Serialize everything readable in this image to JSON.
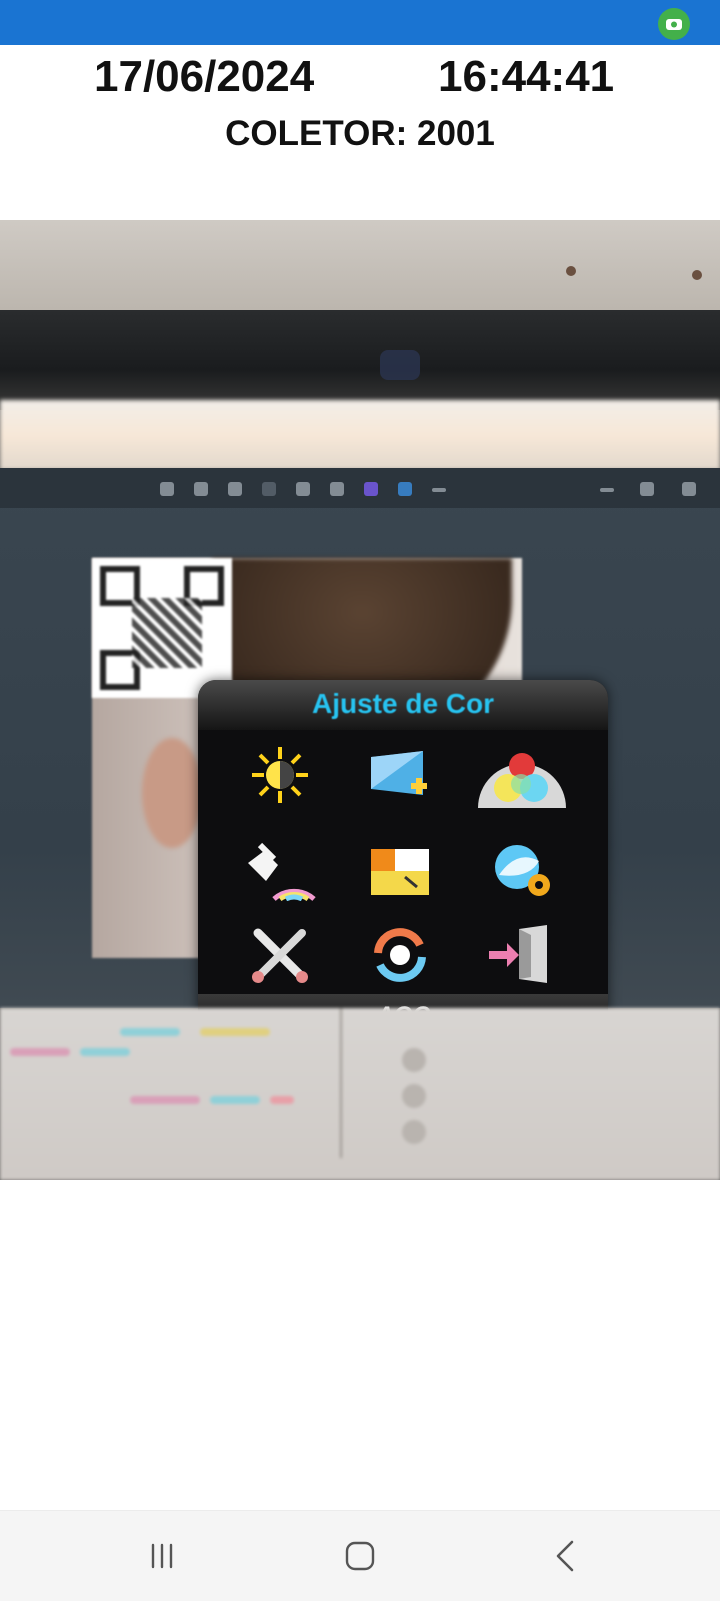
{
  "status_bar": {
    "accent_color": "#1a74d2",
    "camera_indicator_icon": "camera-in-use-icon",
    "indicator_color": "#43b04a"
  },
  "header": {
    "date": "17/06/2024",
    "time": "16:44:41",
    "collector": "COLETOR: 2001"
  },
  "camera_preview": {
    "osd": {
      "title": "Ajuste de Cor",
      "brand": "AOC",
      "tiles": [
        {
          "icon": "brightness-icon"
        },
        {
          "icon": "image-setup-icon"
        },
        {
          "icon": "color-rgb-icon"
        },
        {
          "icon": "picture-boost-icon"
        },
        {
          "icon": "osd-setup-icon"
        },
        {
          "icon": "extra-settings-icon"
        },
        {
          "icon": "tools-icon"
        },
        {
          "icon": "reset-icon"
        },
        {
          "icon": "exit-icon"
        }
      ]
    }
  },
  "nav_bar": {
    "recents_icon": "recents-icon",
    "home_icon": "home-icon",
    "back_icon": "back-icon"
  }
}
